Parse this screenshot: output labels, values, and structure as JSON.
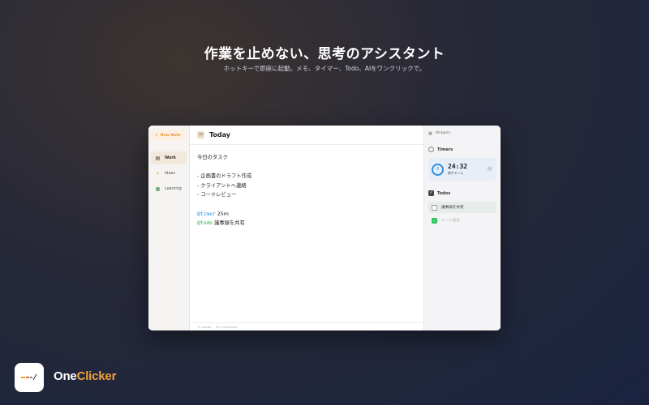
{
  "hero": {
    "title": "作業を止めない、思考のアシスタント",
    "subtitle": "ホットキーで即座に起動。メモ、タイマー、Todo、AIをワンクリックで。"
  },
  "sidebar": {
    "new_note_label": "New Note",
    "items": [
      {
        "label": "Work",
        "icon": "notebook-icon",
        "active": true
      },
      {
        "label": "Ideas",
        "icon": "lightbulb-icon",
        "active": false
      },
      {
        "label": "Learning",
        "icon": "books-icon",
        "active": false
      }
    ]
  },
  "editor": {
    "title": "Today",
    "lines": [
      "今日のタスク",
      "",
      "- 企画書のドラフト作成",
      "- クライアントへ連絡",
      "- コードレビュー",
      ""
    ],
    "timer_mention": "@timer",
    "timer_value": " 25m",
    "todo_mention": "@todo",
    "todo_value": " 議事録を共有",
    "footer_words": "11 words",
    "footer_chars": "61 characters"
  },
  "widgets": {
    "header": "Widgets",
    "timers_label": "Timers",
    "timer": {
      "time": "24:32",
      "label": "集中タイム"
    },
    "todos_label": "Todos",
    "todos": [
      {
        "label": "議事録を共有",
        "done": false
      },
      {
        "label": "メール返信",
        "done": true
      }
    ]
  },
  "brand": {
    "name_white": "One",
    "name_accent": "Clicker",
    "accent_color": "#f2a23a"
  },
  "colors": {
    "timer_mention": "#2f8fe0",
    "todo_mention": "#2eaa55",
    "todo_done": "#2fc35c",
    "new_note": "#e8932b"
  }
}
